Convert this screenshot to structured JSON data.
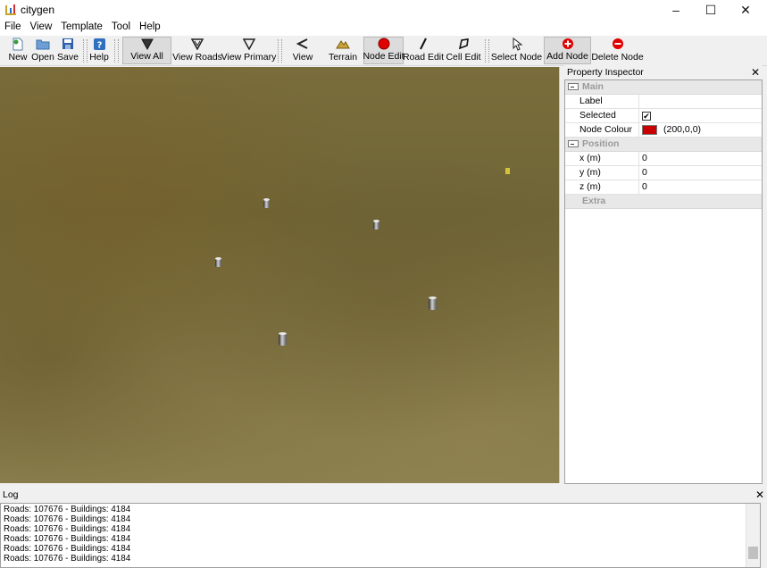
{
  "window": {
    "title": "citygen",
    "minimize": "–",
    "maximize": "☐",
    "close": "✕"
  },
  "menu": [
    "File",
    "View",
    "Template",
    "Tool",
    "Help"
  ],
  "toolbar": {
    "buttons": [
      {
        "label": "New",
        "icon": "new-file-icon"
      },
      {
        "label": "Open",
        "icon": "open-folder-icon"
      },
      {
        "label": "Save",
        "icon": "save-icon"
      },
      {
        "label": "Help",
        "icon": "help-icon"
      },
      {
        "label": "View All",
        "icon": "view-all-icon",
        "checked": true
      },
      {
        "label": "View Roads",
        "icon": "view-roads-icon"
      },
      {
        "label": "View Primary",
        "icon": "view-primary-icon"
      },
      {
        "label": "View",
        "icon": "view-icon"
      },
      {
        "label": "Terrain",
        "icon": "terrain-icon"
      },
      {
        "label": "Node Edit",
        "icon": "node-edit-icon",
        "checked": true
      },
      {
        "label": "Road Edit",
        "icon": "road-edit-icon"
      },
      {
        "label": "Cell Edit",
        "icon": "cell-edit-icon"
      },
      {
        "label": "Select Node",
        "icon": "select-node-icon"
      },
      {
        "label": "Add Node",
        "icon": "add-node-icon",
        "checked": true
      },
      {
        "label": "Delete Node",
        "icon": "delete-node-icon"
      }
    ]
  },
  "inspector": {
    "title": "Property Inspector",
    "close": "✕",
    "groups": {
      "main": "Main",
      "position": "Position",
      "extra": "Extra"
    },
    "props": {
      "label": {
        "key": "Label",
        "value": ""
      },
      "selected": {
        "key": "Selected",
        "value": "✔"
      },
      "node_colour": {
        "key": "Node Colour",
        "value": "(200,0,0)",
        "color": "#c80000"
      },
      "x": {
        "key": "x (m)",
        "value": "0"
      },
      "y": {
        "key": "y (m)",
        "value": "0"
      },
      "z": {
        "key": "z (m)",
        "value": "0"
      }
    }
  },
  "log": {
    "title": "Log",
    "close": "✕",
    "lines": [
      "Roads: 107676 - Buildings: 4184",
      "Roads: 107676 - Buildings: 4184",
      "Roads: 107676 - Buildings: 4184",
      "Roads: 107676 - Buildings: 4184",
      "Roads: 107676 - Buildings: 4184",
      "Roads: 107676 - Buildings: 4184"
    ]
  }
}
